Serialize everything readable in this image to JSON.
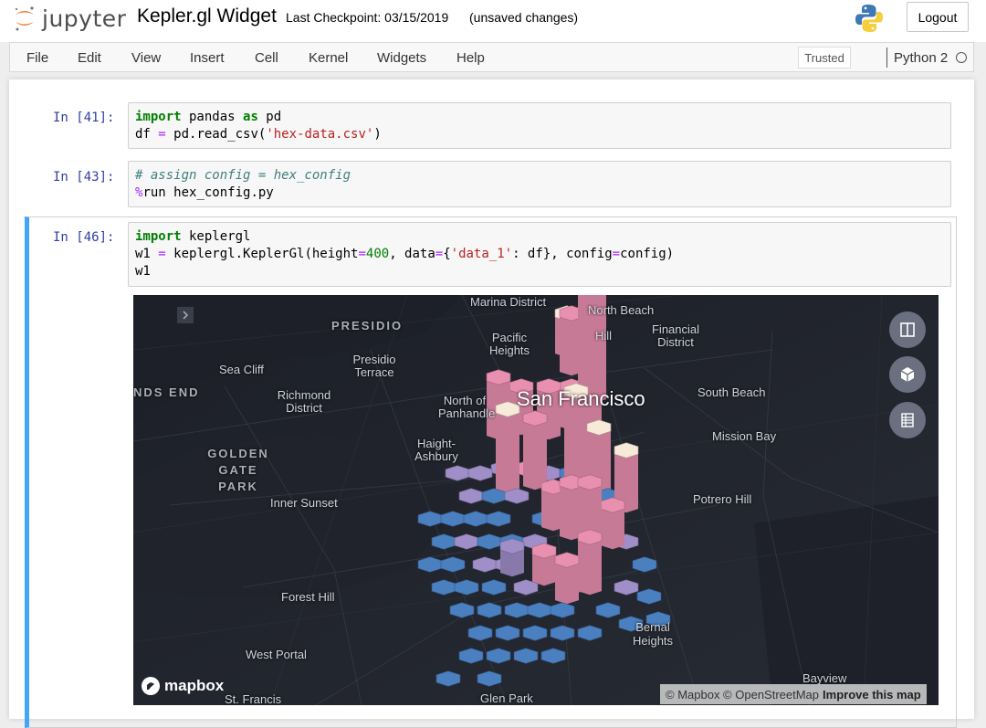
{
  "header": {
    "logo_text": "jupyter",
    "notebook_title": "Kepler.gl Widget",
    "checkpoint": "Last Checkpoint: 03/15/2019",
    "autosave_status": "(unsaved changes)",
    "logout_label": "Logout"
  },
  "menubar": {
    "items": [
      {
        "label": "File"
      },
      {
        "label": "Edit"
      },
      {
        "label": "View"
      },
      {
        "label": "Insert"
      },
      {
        "label": "Cell"
      },
      {
        "label": "Kernel"
      },
      {
        "label": "Widgets"
      },
      {
        "label": "Help"
      }
    ],
    "trusted_label": "Trusted",
    "kernel_name": "Python 2"
  },
  "cells": [
    {
      "prompt": "In [41]:"
    },
    {
      "prompt": "In [43]:"
    },
    {
      "prompt": "In [46]:"
    }
  ],
  "map": {
    "labels": [
      {
        "text": "Marina District"
      },
      {
        "text": "North Beach"
      },
      {
        "text": "PRESIDIO"
      },
      {
        "text": "Pacific Heights"
      },
      {
        "text": "Hill"
      },
      {
        "text": "Financial District"
      },
      {
        "text": "Sea Cliff"
      },
      {
        "text": "Presidio Terrace"
      },
      {
        "text": "NDS END"
      },
      {
        "text": "Richmond District"
      },
      {
        "text": "North of Panhandle"
      },
      {
        "text": "San Francisco"
      },
      {
        "text": "South Beach"
      },
      {
        "text": "Mission Bay"
      },
      {
        "text": "GOLDEN GATE PARK"
      },
      {
        "text": "Haight-Ashbury"
      },
      {
        "text": "Inner Sunset"
      },
      {
        "text": "Potrero Hill"
      },
      {
        "text": "Forest Hill"
      },
      {
        "text": "Bernal Heights"
      },
      {
        "text": "West Portal"
      },
      {
        "text": "Bayview"
      },
      {
        "text": "St. Francis"
      },
      {
        "text": "Glen Park"
      }
    ],
    "controls": [
      {
        "icon": "split-map-icon"
      },
      {
        "icon": "3d-view-icon"
      },
      {
        "icon": "legend-icon"
      }
    ],
    "mapbox_label": "mapbox",
    "attribution": {
      "text": "© Mapbox © OpenStreetMap",
      "link": "Improve this map"
    },
    "colors": {
      "background": "#242730",
      "low": "#4a7fc0",
      "mid": "#a08ec8",
      "high": "#e98fb0",
      "top": "#f7ead8"
    }
  },
  "colors": {
    "prompt": "#303f9f",
    "selected_cell_border": "#42a5f5",
    "keyword": "#008000",
    "string": "#ba2121",
    "operator": "#aa22ff",
    "comment": "#408080"
  }
}
